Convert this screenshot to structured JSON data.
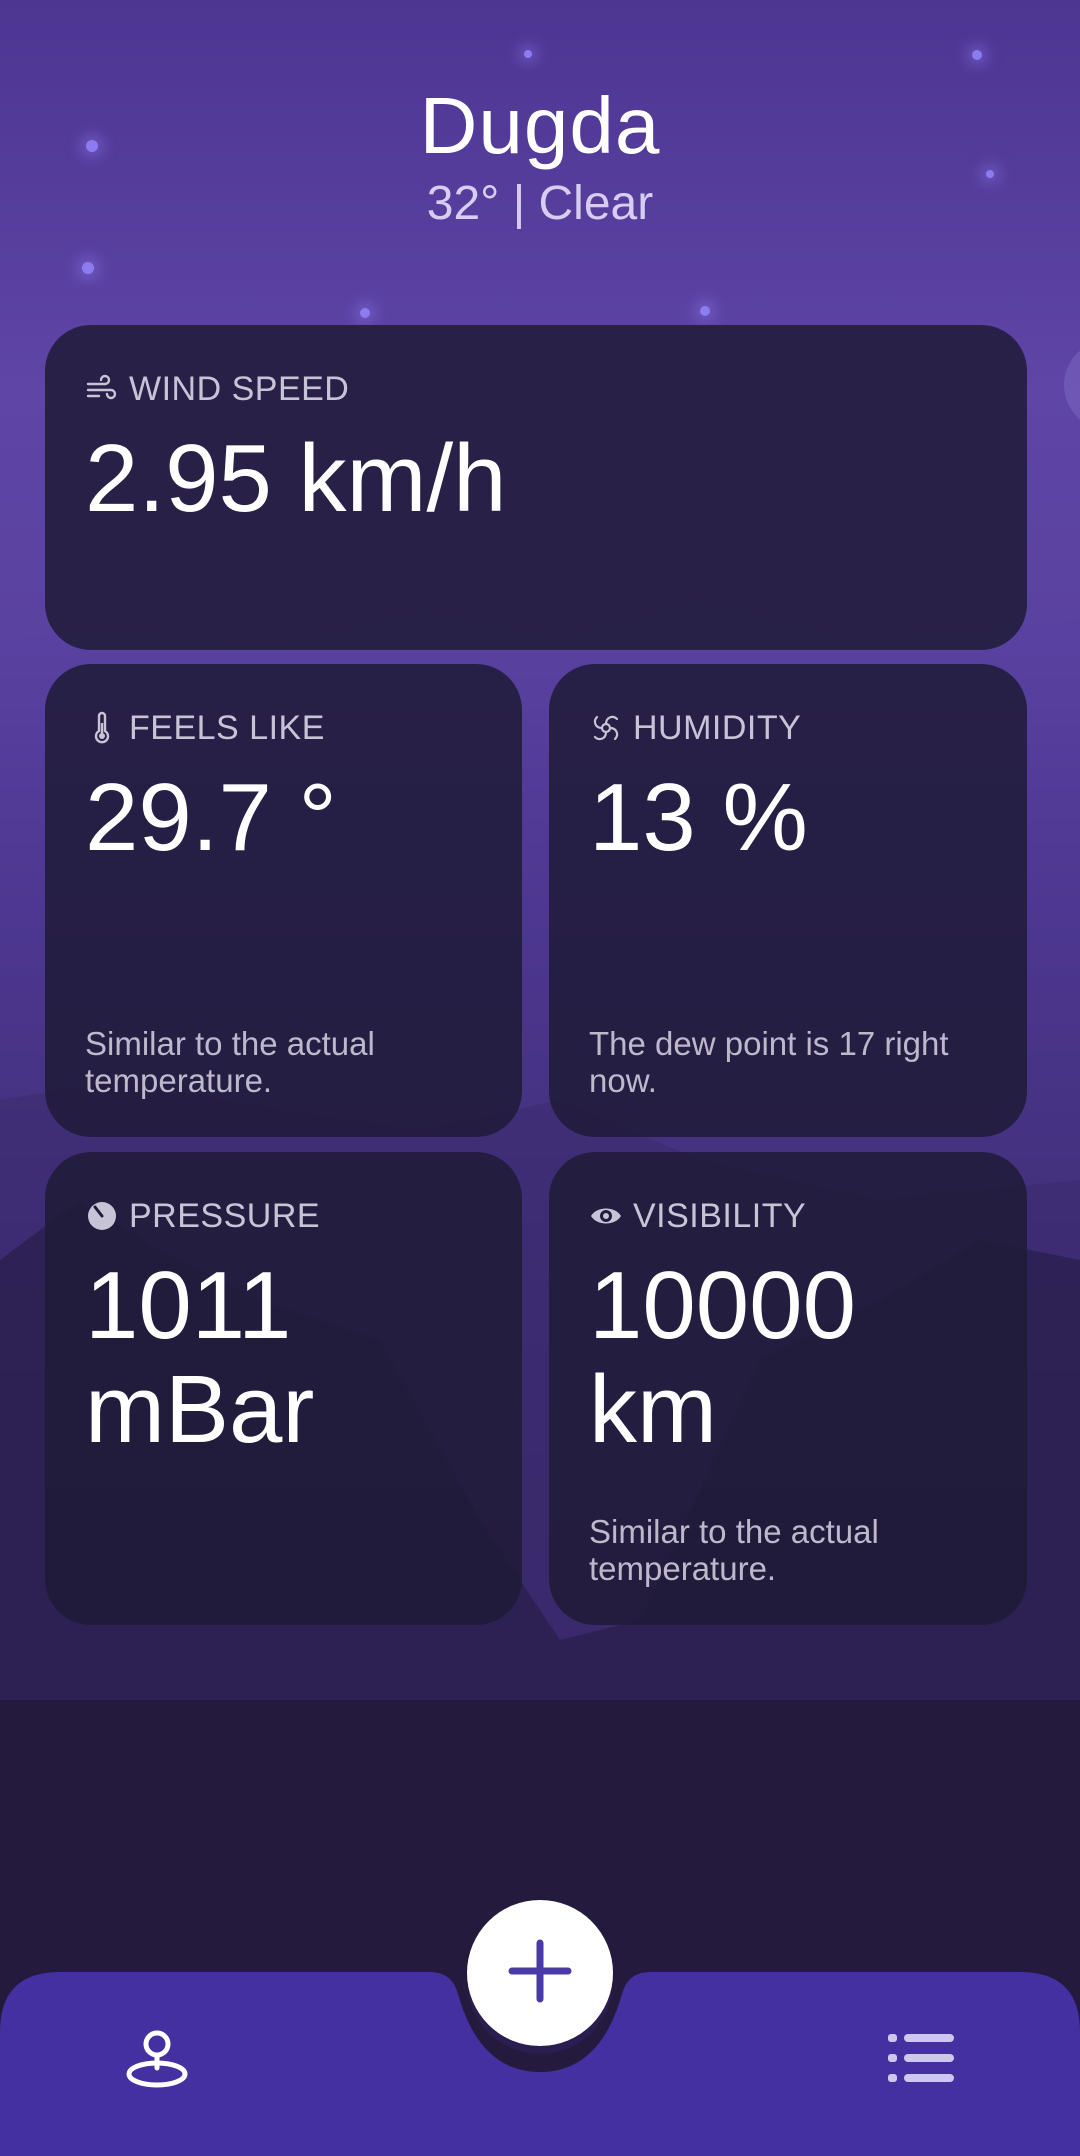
{
  "location": {
    "city": "Dugda",
    "summary": "32° | Clear"
  },
  "cards": {
    "wind": {
      "label": "WIND SPEED",
      "value": "2.95 km/h",
      "icon": "wind-icon"
    },
    "feels_like": {
      "label": "FEELS LIKE",
      "value": "29.7 °",
      "note": "Similar to the actual temperature.",
      "icon": "thermometer-icon"
    },
    "humidity": {
      "label": "HUMIDITY",
      "value": "13 %",
      "note": "The dew point is 17 right now.",
      "icon": "humidity-swirl-icon"
    },
    "pressure": {
      "label": "PRESSURE",
      "value_line1": "1011",
      "value_line2": "mBar",
      "icon": "pressure-gauge-icon"
    },
    "visibility": {
      "label": "VISIBILITY",
      "value_line1": "10000",
      "value_line2": "km",
      "note": "Similar to the actual temperature.",
      "icon": "eye-icon"
    }
  },
  "nav": {
    "left_icon": "location-pin-icon",
    "center_icon": "plus-icon",
    "right_icon": "list-icon"
  },
  "colors": {
    "nav_bar": "#4430a0",
    "card_bg": "#201b38",
    "accent": "#4a3aa8"
  }
}
